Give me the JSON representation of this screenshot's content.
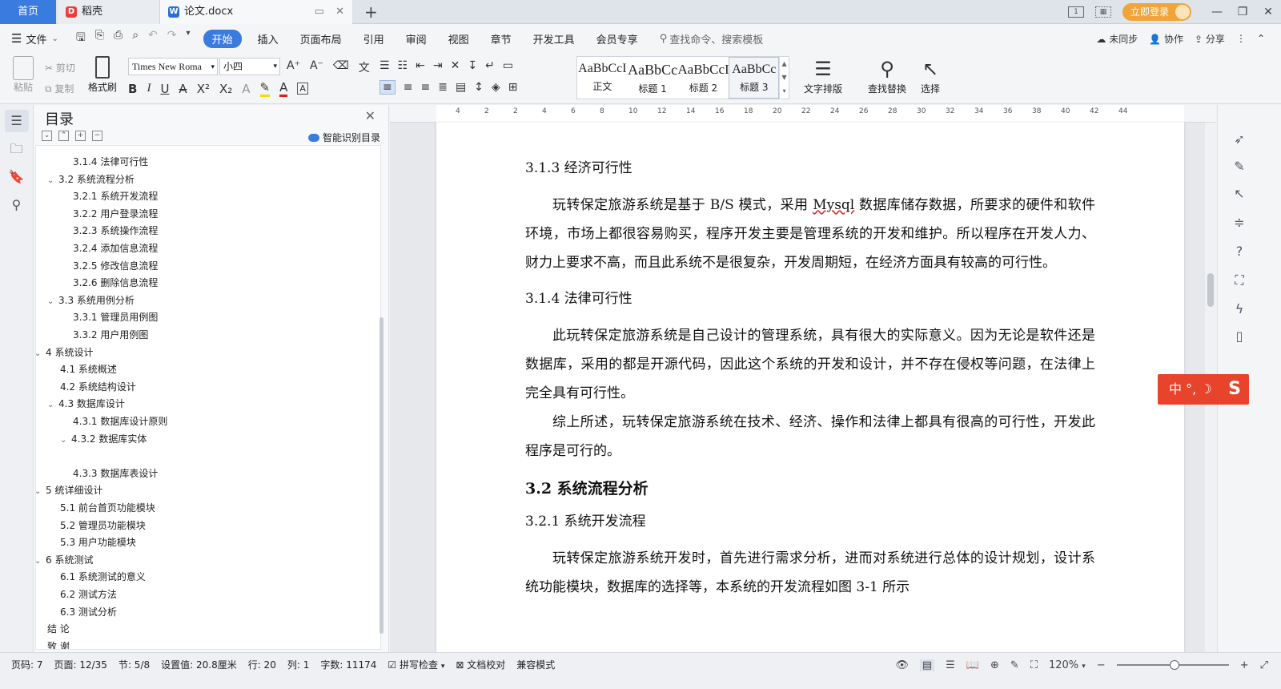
{
  "tabs": {
    "home": "首页",
    "daoke": "稻壳",
    "doc": "论文.docx",
    "add": "+"
  },
  "titlebar": {
    "login": "立即登录",
    "minimize": "—",
    "restore": "❐",
    "close": "✕"
  },
  "menu": {
    "file": "文件",
    "items": [
      "开始",
      "插入",
      "页面布局",
      "引用",
      "审阅",
      "视图",
      "章节",
      "开发工具",
      "会员专享"
    ],
    "active": "开始",
    "search": "查找命令、搜索模板",
    "sync": "未同步",
    "collab": "协作",
    "share": "分享"
  },
  "ribbon": {
    "paste": "粘贴",
    "cut": "剪切",
    "copy": "复制",
    "format_painter": "格式刷",
    "font_name": "Times New Roma",
    "font_size": "小四",
    "styles": [
      {
        "sample": "AaBbCcI",
        "name": "正文"
      },
      {
        "sample": "AaBbCc",
        "name": "标题 1"
      },
      {
        "sample": "AaBbCcI",
        "name": "标题 2"
      },
      {
        "sample": "AaBbCc",
        "name": "标题 3"
      }
    ],
    "text_layout": "文字排版",
    "find_replace": "查找替换",
    "select": "选择"
  },
  "toc": {
    "title": "目录",
    "smart": "智能识别目录",
    "items": [
      {
        "text": "3.1.4  法律可行性",
        "level": 3,
        "caret": ""
      },
      {
        "text": "3.2 系统流程分析",
        "level": 2,
        "caret": "v"
      },
      {
        "text": "3.2.1 系统开发流程",
        "level": 3,
        "caret": ""
      },
      {
        "text": "3.2.2  用户登录流程",
        "level": 3,
        "caret": ""
      },
      {
        "text": "3.2.3  系统操作流程",
        "level": 3,
        "caret": ""
      },
      {
        "text": "3.2.4  添加信息流程",
        "level": 3,
        "caret": ""
      },
      {
        "text": "3.2.5  修改信息流程",
        "level": 3,
        "caret": ""
      },
      {
        "text": "3.2.6  删除信息流程",
        "level": 3,
        "caret": ""
      },
      {
        "text": "3.3 系统用例分析",
        "level": 2,
        "caret": "v"
      },
      {
        "text": "3.3.1 管理员用例图",
        "level": 3,
        "caret": ""
      },
      {
        "text": "3.3.2 用户用例图",
        "level": 3,
        "caret": ""
      },
      {
        "text": "4  系统设计",
        "level": 1,
        "caret": "v"
      },
      {
        "text": "4.1  系统概述",
        "level": 2,
        "caret": ""
      },
      {
        "text": "4.2  系统结构设计",
        "level": 2,
        "caret": ""
      },
      {
        "text": "4.3 数据库设计",
        "level": 2,
        "caret": "v"
      },
      {
        "text": "4.3.1  数据库设计原则",
        "level": 3,
        "caret": ""
      },
      {
        "text": "4.3.2  数据库实体",
        "level": 3,
        "caret": "v"
      },
      {
        "text": "",
        "level": 3,
        "caret": ""
      },
      {
        "text": "4.3.3  数据库表设计",
        "level": 3,
        "caret": ""
      },
      {
        "text": "5 统详细设计",
        "level": 1,
        "caret": "v"
      },
      {
        "text": "5.1 前台首页功能模块",
        "level": 2,
        "caret": ""
      },
      {
        "text": "5.2 管理员功能模块",
        "level": 2,
        "caret": ""
      },
      {
        "text": "5.3 用户功能模块",
        "level": 2,
        "caret": ""
      },
      {
        "text": "6 系统测试",
        "level": 1,
        "caret": "v"
      },
      {
        "text": "6.1 系统测试的意义",
        "level": 2,
        "caret": ""
      },
      {
        "text": "6.2  测试方法",
        "level": 2,
        "caret": ""
      },
      {
        "text": "6.3 测试分析",
        "level": 2,
        "caret": ""
      },
      {
        "text": "结    论",
        "level": 1,
        "caret": ""
      },
      {
        "text": "致    谢",
        "level": 1,
        "caret": ""
      }
    ]
  },
  "document": {
    "h_313": "3.1.3  经济可行性",
    "p1_a": "玩转保定旅游系统是基于 B/S 模式，采用 ",
    "p1_mysql": "Mysql",
    "p1_b": " 数据库储存数据，所要求的硬件和软件环境，市场上都很容易购买，程序开发主要是管理系统的开发和维护。所以程序在开发人力、财力上要求不高，而且此系统不是很复杂，开发周期短，在经济方面具有较高的可行性。",
    "h_314": "3.1.4  法律可行性",
    "p2": "此玩转保定旅游系统是自己设计的管理系统，具有很大的实际意义。因为无论是软件还是数据库，采用的都是开源代码，因此这个系统的开发和设计，并不存在侵权等问题，在法律上完全具有可行性。",
    "p3": "综上所述，玩转保定旅游系统在技术、经济、操作和法律上都具有很高的可行性，开发此程序是可行的。",
    "h_32": "3.2 系统流程分析",
    "h_321": "3.2.1 系统开发流程",
    "p4": "玩转保定旅游系统开发时，首先进行需求分析，进而对系统进行总体的设计规划，设计系统功能模块，数据库的选择等，本系统的开发流程如图 3-1 所示"
  },
  "ruler": [
    "4",
    "2",
    "2",
    "4",
    "6",
    "8",
    "10",
    "12",
    "14",
    "16",
    "18",
    "20",
    "22",
    "24",
    "26",
    "28",
    "30",
    "32",
    "34",
    "36",
    "38",
    "40",
    "42",
    "44"
  ],
  "ime": "中 °, ☽",
  "status": {
    "page": "页码: 7",
    "pages": "页面: 12/35",
    "section": "节: 5/8",
    "setting": "设置值: 20.8厘米",
    "row": "行: 20",
    "col": "列: 1",
    "words": "字数: 11174",
    "spell": "拼写检查",
    "proof": "文档校对",
    "compat": "兼容模式",
    "zoom": "120%"
  },
  "colors": {
    "accent": "#3a7be0",
    "login": "#f1a43a",
    "ime": "#e8432b"
  }
}
